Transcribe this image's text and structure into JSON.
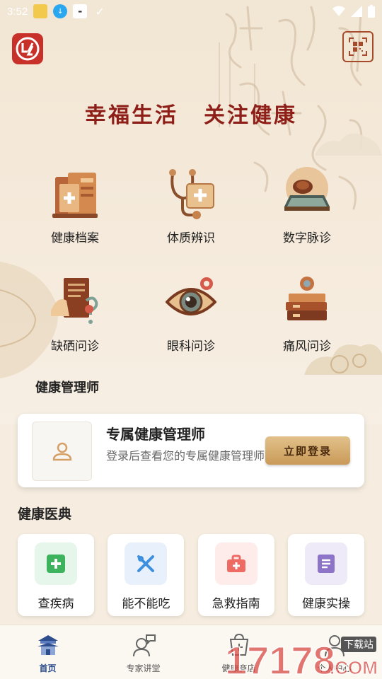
{
  "status_bar": {
    "time": "3:52"
  },
  "header": {
    "slogan_left": "幸福生活",
    "slogan_right": "关注健康"
  },
  "features": [
    {
      "label": "健康档案",
      "icon": "health-record-icon"
    },
    {
      "label": "体质辨识",
      "icon": "stethoscope-icon"
    },
    {
      "label": "数字脉诊",
      "icon": "pulse-pillow-icon"
    },
    {
      "label": "缺硒问诊",
      "icon": "selenium-consult-icon"
    },
    {
      "label": "眼科问诊",
      "icon": "eye-icon"
    },
    {
      "label": "痛风问诊",
      "icon": "gout-books-icon"
    }
  ],
  "manager_section": {
    "title": "健康管理师",
    "card_title": "专属健康管理师",
    "card_desc": "登录后查看您的专属健康管理师",
    "login_label": "立即登录"
  },
  "dictionary_section": {
    "title": "健康医典",
    "items": [
      {
        "label": "查疾病",
        "icon": "plus-cross-icon",
        "bg": "#e6f6ea",
        "color": "#3cb35c"
      },
      {
        "label": "能不能吃",
        "icon": "fork-spoon-icon",
        "bg": "#e8f1fb",
        "color": "#3d8fe0"
      },
      {
        "label": "急救指南",
        "icon": "first-aid-kit-icon",
        "bg": "#fdecea",
        "color": "#ee6b63"
      },
      {
        "label": "健康实操",
        "icon": "document-icon",
        "bg": "#efeaf8",
        "color": "#8d74c9"
      }
    ]
  },
  "tabbar": [
    {
      "label": "首页",
      "icon": "temple-icon",
      "active": true
    },
    {
      "label": "专家讲堂",
      "icon": "expert-chat-icon",
      "active": false
    },
    {
      "label": "健康商店",
      "icon": "shop-icon",
      "active": false
    },
    {
      "label": "个人中心",
      "icon": "user-icon",
      "active": false
    }
  ],
  "watermark": {
    "brand": "17178.COM",
    "tag": "下载站"
  },
  "colors": {
    "accent": "#8e1e18",
    "gold": "#c99a58",
    "tab_active": "#2d4d8c"
  }
}
